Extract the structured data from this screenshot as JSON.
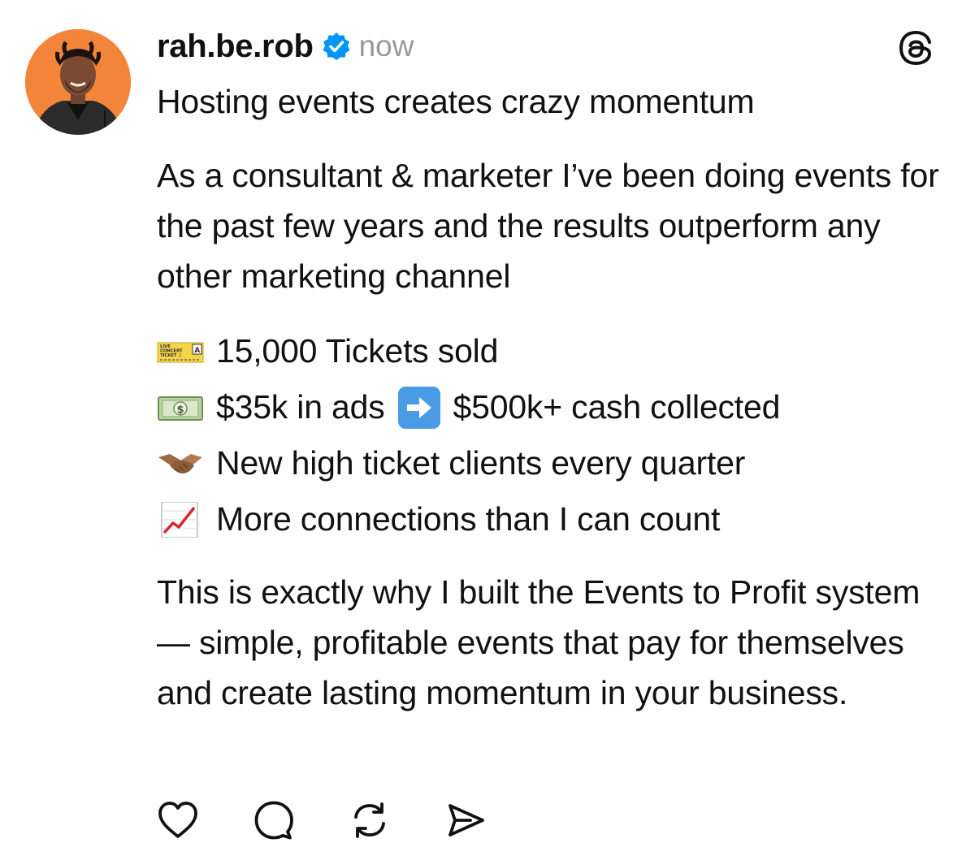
{
  "post": {
    "username": "rah.be.rob",
    "timestamp": "now",
    "headline": "Hosting events creates crazy momentum",
    "paragraph1": "As a consultant & marketer I’ve been doing events for the past few years and the results outperform any other marketing channel",
    "list": [
      {
        "icon": "ticket-icon",
        "text": "15,000 Tickets sold"
      },
      {
        "icon": "money-icon",
        "text_before": "$35k in ads",
        "inline_icon": "right-arrow-icon",
        "text_after": "$500k+ cash collected"
      },
      {
        "icon": "handshake-icon",
        "text": "New high ticket clients every quarter"
      },
      {
        "icon": "chart-increasing-icon",
        "text": "More connections than I can count"
      }
    ],
    "paragraph2": "This is exactly why I built the Events to Profit system — simple, profitable events that pay for themselves and create lasting momentum in your business.",
    "ticket_emoji_text": {
      "line1": "LIVE",
      "line2": "CONCERT",
      "line3": "TICKET ♫",
      "seat": "A"
    },
    "money_emoji_symbol": "$"
  },
  "actions": [
    {
      "name": "like-button",
      "icon": "heart-icon"
    },
    {
      "name": "reply-button",
      "icon": "comment-icon"
    },
    {
      "name": "repost-button",
      "icon": "repost-icon"
    },
    {
      "name": "share-button",
      "icon": "send-icon"
    }
  ],
  "colors": {
    "avatar_background": "#f2853a",
    "verified_blue": "#0095f6",
    "timestamp_gray": "#999999",
    "text": "#111111"
  }
}
